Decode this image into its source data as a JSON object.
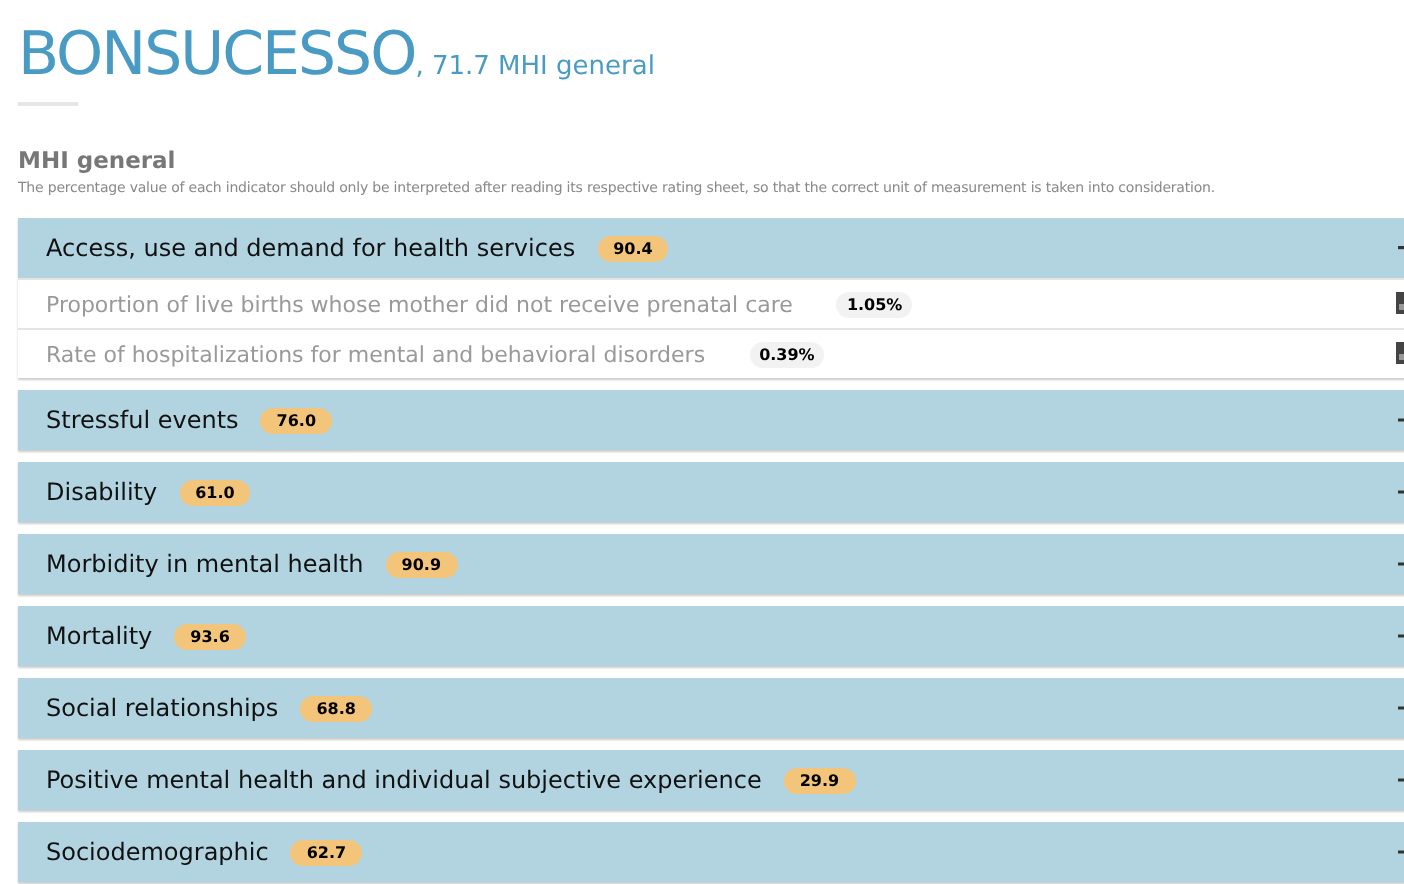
{
  "header": {
    "title": "BONSUCESSO",
    "score": ", 71.7 MHI general"
  },
  "section": {
    "title": "MHI general",
    "note": "The percentage value of each indicator should only be interpreted after reading its respective rating sheet, so that the correct unit of measurement is taken into consideration."
  },
  "groups": [
    {
      "name": "Access, use and demand for health services",
      "score": "90.4",
      "expanded": true,
      "indicators": [
        {
          "name": "Proportion of live births whose mother did not receive prenatal care",
          "value": "1.05%"
        },
        {
          "name": "Rate of hospitalizations for mental and behavioral disorders",
          "value": "0.39%"
        }
      ]
    },
    {
      "name": "Stressful events",
      "score": "76.0",
      "expanded": false
    },
    {
      "name": "Disability",
      "score": "61.0",
      "expanded": false
    },
    {
      "name": "Morbidity in mental health",
      "score": "90.9",
      "expanded": false
    },
    {
      "name": "Mortality",
      "score": "93.6",
      "expanded": false
    },
    {
      "name": "Social relationships",
      "score": "68.8",
      "expanded": false
    },
    {
      "name": "Positive mental health and individual subjective experience",
      "score": "29.9",
      "expanded": false
    },
    {
      "name": "Sociodemographic",
      "score": "62.7",
      "expanded": false
    }
  ]
}
